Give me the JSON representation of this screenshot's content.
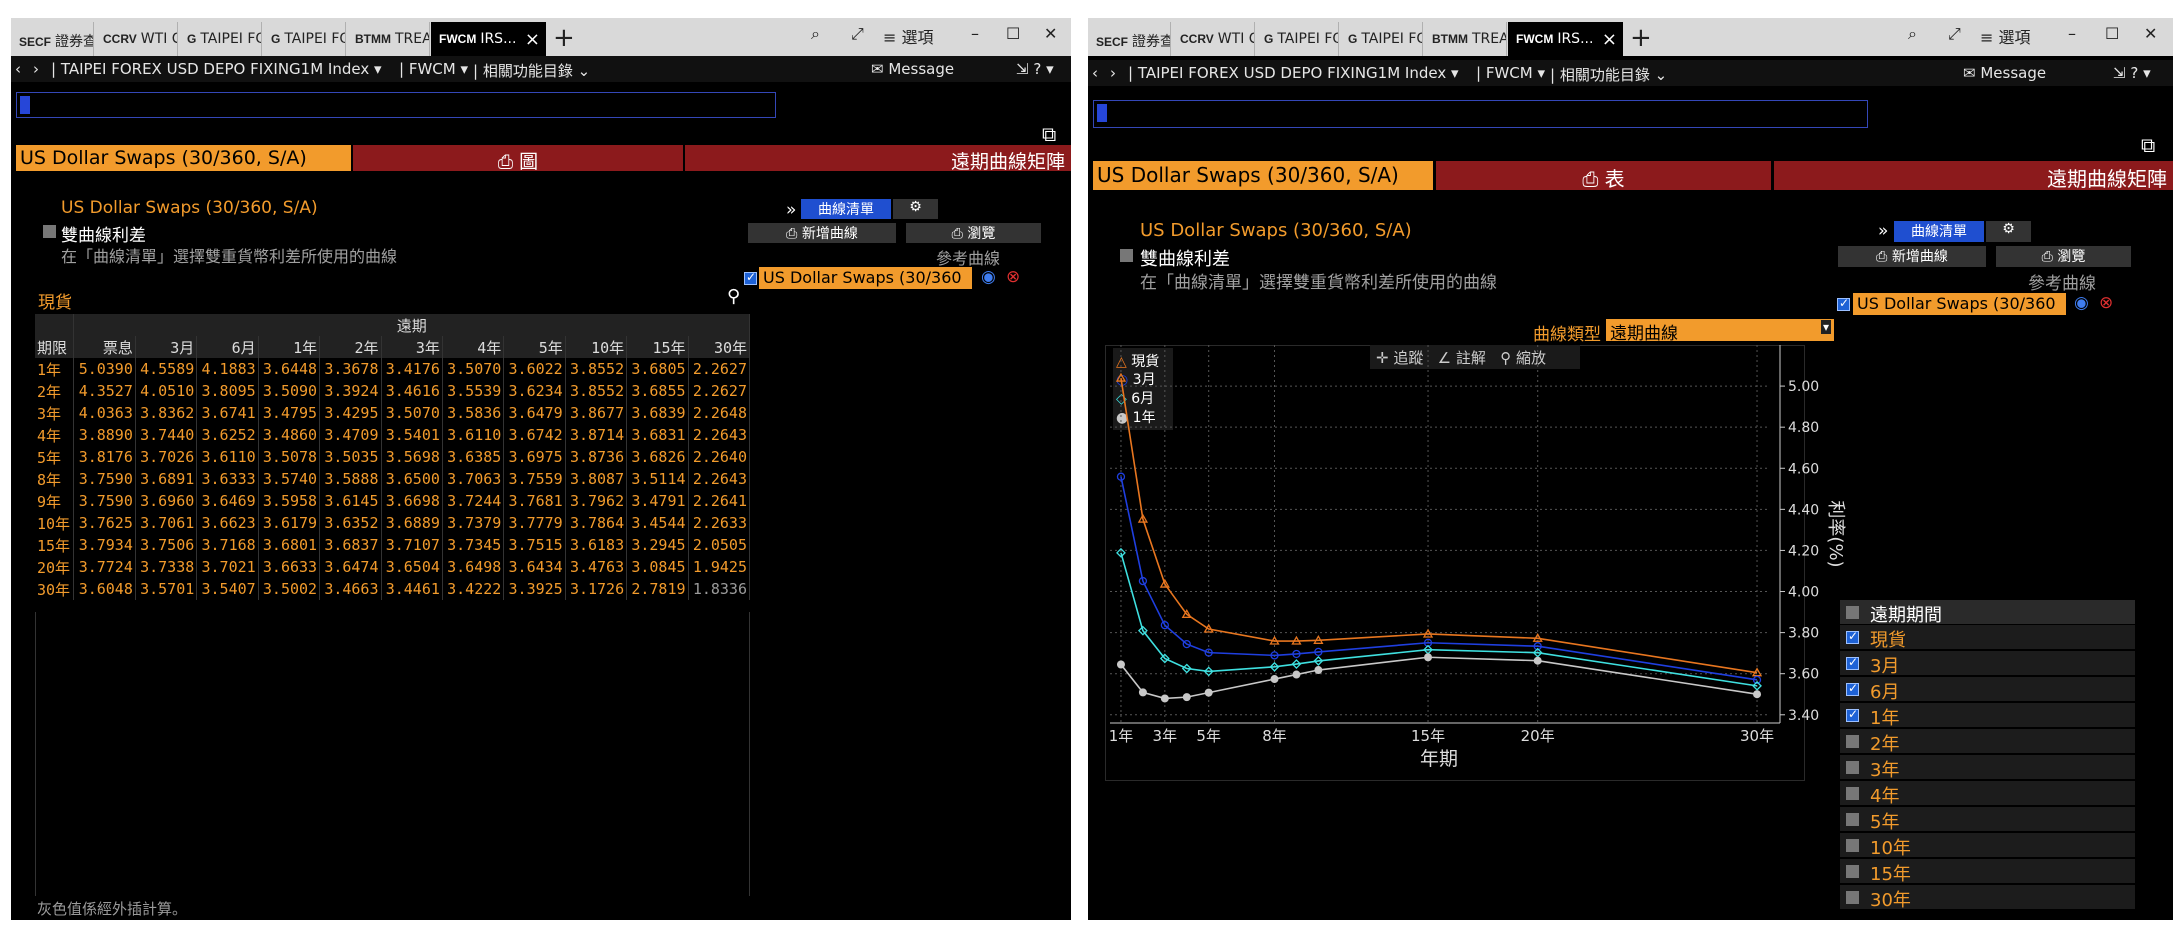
{
  "tabs": [
    {
      "code": "SECF",
      "label": "證券查..."
    },
    {
      "code": "CCRV",
      "label": "WTI C..."
    },
    {
      "code": "G",
      "label": "TAIPEI FO..."
    },
    {
      "code": "G",
      "label": "TAIPEI FO..."
    },
    {
      "code": "BTMM",
      "label": "TREA..."
    },
    {
      "code": "FWCM",
      "label": "IRS..."
    }
  ],
  "window_controls": {
    "options": "≡ 選項"
  },
  "nav": {
    "security": "TAIPEI FOREX USD DEPO FIXING1M Index",
    "function": "FWCM",
    "related": "相關功能目錄",
    "message": "Message"
  },
  "header": {
    "curve_name": "US Dollar Swaps (30/360, S/A)",
    "view_table_label": "表",
    "view_chart_label": "圖",
    "forward_matrix": "遠期曲線矩陣"
  },
  "dual_curve": {
    "curve_title": "US Dollar Swaps (30/360, S/A)",
    "label": "雙曲線利差",
    "hint": "在「曲線清單」選擇雙重貨幣利差所使用的曲線"
  },
  "curve_panel": {
    "curve_list": "曲線清單",
    "new_curve": "新增曲線",
    "browse": "瀏覽",
    "reference": "參考曲線",
    "curve_entry": "US Dollar Swaps (30/360"
  },
  "left": {
    "spot_label": "現貨",
    "forward_header": "遠期",
    "tenor_header": "期限",
    "columns": [
      "票息",
      "3月",
      "6月",
      "1年",
      "2年",
      "3年",
      "4年",
      "5年",
      "10年",
      "15年",
      "30年"
    ],
    "rows": [
      {
        "tenor": "1年",
        "values": [
          "5.0390",
          "4.5589",
          "4.1883",
          "3.6448",
          "3.3678",
          "3.4176",
          "3.5070",
          "3.6022",
          "3.8552",
          "3.6805",
          "2.2627"
        ]
      },
      {
        "tenor": "2年",
        "values": [
          "4.3527",
          "4.0510",
          "3.8095",
          "3.5090",
          "3.3924",
          "3.4616",
          "3.5539",
          "3.6234",
          "3.8552",
          "3.6855",
          "2.2627"
        ]
      },
      {
        "tenor": "3年",
        "values": [
          "4.0363",
          "3.8362",
          "3.6741",
          "3.4795",
          "3.4295",
          "3.5070",
          "3.5836",
          "3.6479",
          "3.8677",
          "3.6839",
          "2.2648"
        ]
      },
      {
        "tenor": "4年",
        "values": [
          "3.8890",
          "3.7440",
          "3.6252",
          "3.4860",
          "3.4709",
          "3.5401",
          "3.6110",
          "3.6742",
          "3.8714",
          "3.6831",
          "2.2643"
        ]
      },
      {
        "tenor": "5年",
        "values": [
          "3.8176",
          "3.7026",
          "3.6110",
          "3.5078",
          "3.5035",
          "3.5698",
          "3.6385",
          "3.6975",
          "3.8736",
          "3.6826",
          "2.2640"
        ]
      },
      {
        "tenor": "8年",
        "values": [
          "3.7590",
          "3.6891",
          "3.6333",
          "3.5740",
          "3.5888",
          "3.6500",
          "3.7063",
          "3.7559",
          "3.8087",
          "3.5114",
          "2.2643"
        ]
      },
      {
        "tenor": "9年",
        "values": [
          "3.7590",
          "3.6960",
          "3.6469",
          "3.5958",
          "3.6145",
          "3.6698",
          "3.7244",
          "3.7681",
          "3.7962",
          "3.4791",
          "2.2641"
        ]
      },
      {
        "tenor": "10年",
        "values": [
          "3.7625",
          "3.7061",
          "3.6623",
          "3.6179",
          "3.6352",
          "3.6889",
          "3.7379",
          "3.7779",
          "3.7864",
          "3.4544",
          "2.2633"
        ]
      },
      {
        "tenor": "15年",
        "values": [
          "3.7934",
          "3.7506",
          "3.7168",
          "3.6801",
          "3.6837",
          "3.7107",
          "3.7345",
          "3.7515",
          "3.6183",
          "3.2945",
          "2.0505"
        ]
      },
      {
        "tenor": "20年",
        "values": [
          "3.7724",
          "3.7338",
          "3.7021",
          "3.6633",
          "3.6474",
          "3.6504",
          "3.6498",
          "3.6434",
          "3.4763",
          "3.0845",
          "1.9425"
        ]
      },
      {
        "tenor": "30年",
        "values": [
          "3.6048",
          "3.5701",
          "3.5407",
          "3.5002",
          "3.4663",
          "3.4461",
          "3.4222",
          "3.3925",
          "3.1726",
          "2.7819",
          "1.8336"
        ]
      }
    ],
    "footnote": "灰色值係經外插計算。"
  },
  "right": {
    "curve_type_label": "曲線類型",
    "curve_type_value": "遠期曲線",
    "toolbar": {
      "track": "追蹤",
      "annotate": "註解",
      "zoom": "縮放"
    },
    "legend_header": "遠期期間",
    "legend_items": [
      {
        "label": "現貨",
        "checked": true
      },
      {
        "label": "3月",
        "checked": true
      },
      {
        "label": "6月",
        "checked": true
      },
      {
        "label": "1年",
        "checked": true
      },
      {
        "label": "2年",
        "checked": false
      },
      {
        "label": "3年",
        "checked": false
      },
      {
        "label": "4年",
        "checked": false
      },
      {
        "label": "5年",
        "checked": false
      },
      {
        "label": "10年",
        "checked": false
      },
      {
        "label": "15年",
        "checked": false
      },
      {
        "label": "30年",
        "checked": false
      }
    ]
  },
  "chart_data": {
    "type": "line",
    "xlabel": "年期",
    "ylabel": "利率(%)",
    "x_ticks": [
      "1年",
      "3年",
      "5年",
      "8年",
      "15年",
      "20年",
      "30年"
    ],
    "y_ticks": [
      3.4,
      3.6,
      3.8,
      4.0,
      4.2,
      4.4,
      4.6,
      4.8,
      5.0
    ],
    "ylim": [
      3.36,
      5.2
    ],
    "xlim": [
      0.5,
      30.5
    ],
    "x": [
      1,
      2,
      3,
      4,
      5,
      8,
      9,
      10,
      15,
      20,
      30
    ],
    "series": [
      {
        "name": "現貨",
        "color": "#e8761f",
        "values": [
          5.039,
          4.3527,
          4.0363,
          3.889,
          3.8176,
          3.759,
          3.759,
          3.7625,
          3.7934,
          3.7724,
          3.6048
        ]
      },
      {
        "name": "3月",
        "color": "#1f3fe0",
        "values": [
          4.5589,
          4.051,
          3.8362,
          3.744,
          3.7026,
          3.6891,
          3.696,
          3.7061,
          3.7506,
          3.7338,
          3.5701
        ]
      },
      {
        "name": "6月",
        "color": "#3fe0e0",
        "values": [
          4.1883,
          3.8095,
          3.6741,
          3.6252,
          3.611,
          3.6333,
          3.6469,
          3.6623,
          3.7168,
          3.7021,
          3.5407
        ]
      },
      {
        "name": "1年",
        "color": "#c8c8c8",
        "values": [
          3.6448,
          3.509,
          3.4795,
          3.486,
          3.5078,
          3.574,
          3.5958,
          3.6179,
          3.6801,
          3.6633,
          3.5002
        ]
      }
    ]
  }
}
